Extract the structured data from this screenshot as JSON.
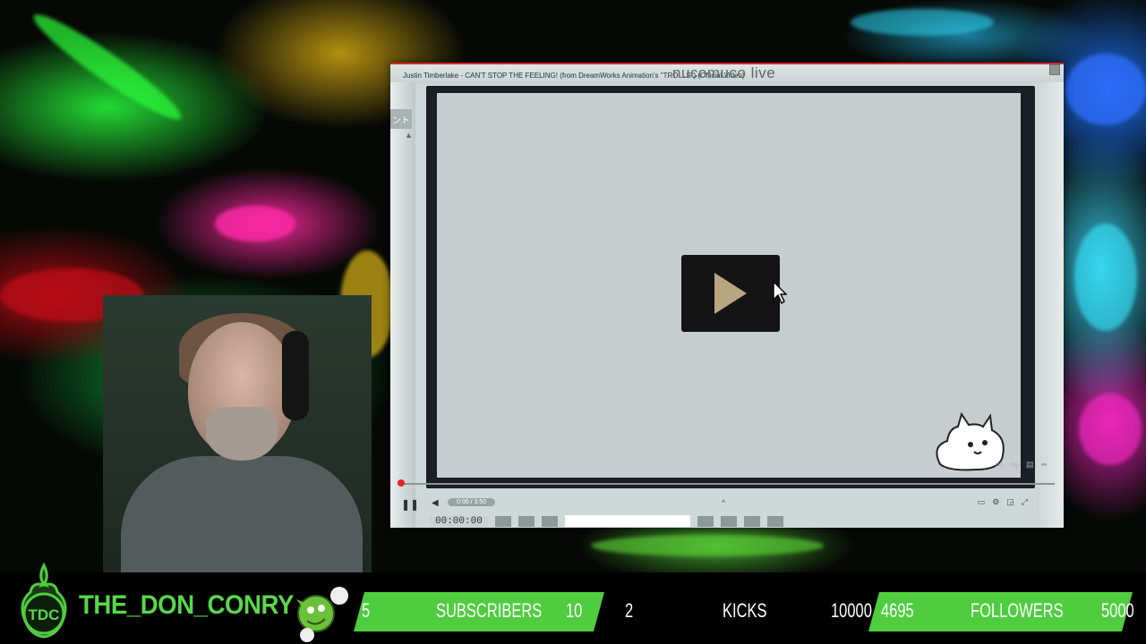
{
  "player": {
    "video_title": "Justin Timberlake - CAN'T STOP THE FEELING! (from DreamWorks Animation's \"TROLLS\") (Official Video)",
    "site_logo": "nucomuco live",
    "left_tab": "ント",
    "time_display": "0:00 / 3:50",
    "counter": "00:00:00",
    "play_icon": "play-icon",
    "accent_color": "#e8242a",
    "progress": 0
  },
  "overlay": {
    "username": "THE_DON_CONRY",
    "subscribers": {
      "current": "5",
      "label": "SUBSCRIBERS",
      "goal": "10"
    },
    "kicks": {
      "current": "2",
      "label": "KICKS",
      "goal": "10000"
    },
    "followers": {
      "current": "4695",
      "label": "FOLLOWERS",
      "goal": "5000"
    },
    "logo_text": "TDC",
    "brand_color": "#57d84b",
    "bar_color": "#4fcd3f"
  }
}
